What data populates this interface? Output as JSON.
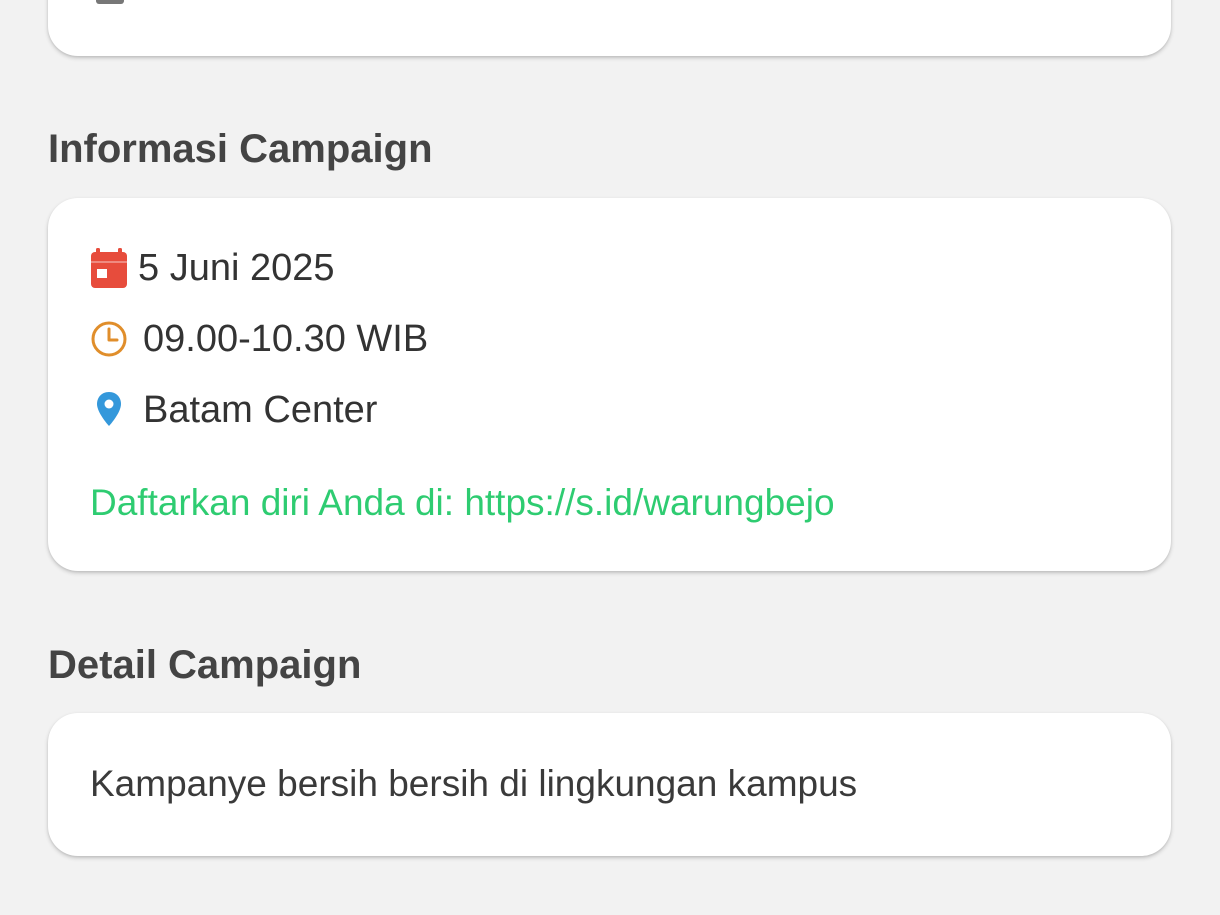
{
  "sections": {
    "info_title": "Informasi Campaign",
    "detail_title": "Detail Campaign"
  },
  "info": {
    "date": "5 Juni 2025",
    "time": "09.00-10.30 WIB",
    "location": "Batam Center",
    "register_text": "Daftarkan diri Anda di: https://s.id/warungbejo"
  },
  "detail": {
    "description": "Kampanye bersih bersih di lingkungan kampus"
  },
  "icons": {
    "date": "calendar-icon",
    "time": "clock-icon",
    "location": "location-pin-icon"
  },
  "colors": {
    "background": "#f2f2f2",
    "card": "#ffffff",
    "calendar": "#e74c3c",
    "clock": "#e08e2b",
    "pin": "#3498db",
    "link": "#2ecc71"
  }
}
